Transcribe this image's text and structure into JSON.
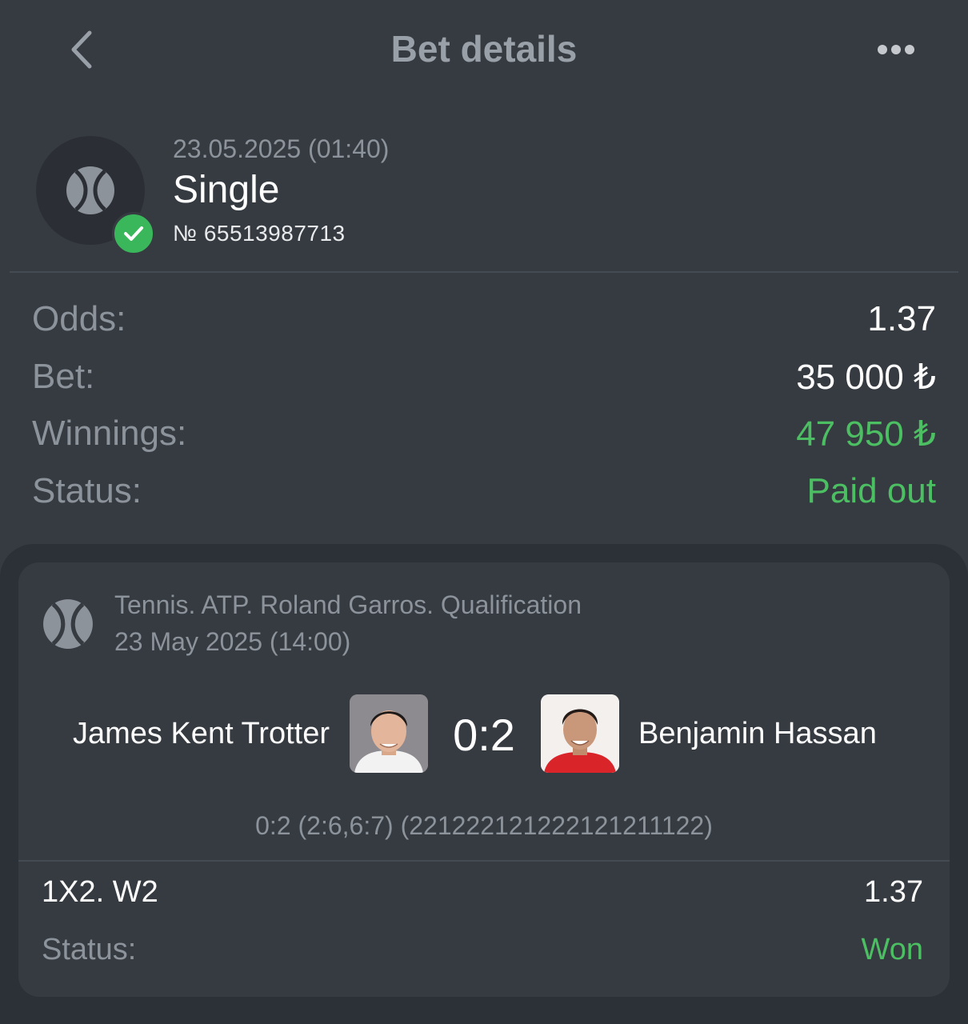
{
  "header": {
    "title": "Bet details",
    "back_icon": "chevron-left-icon",
    "more_icon": "more-horizontal-icon"
  },
  "summary": {
    "date": "23.05.2025 (01:40)",
    "type": "Single",
    "number": "№ 65513987713",
    "sport_icon": "tennis-ball-icon",
    "badge_icon": "check-icon"
  },
  "details": [
    {
      "label": "Odds:",
      "value": "1.37",
      "highlight": false
    },
    {
      "label": "Bet:",
      "value": "35 000 ₺",
      "highlight": false
    },
    {
      "label": "Winnings:",
      "value": "47 950 ₺",
      "highlight": true
    },
    {
      "label": "Status:",
      "value": "Paid out",
      "highlight": true
    }
  ],
  "event": {
    "tournament": "Tennis. ATP. Roland Garros. Qualification",
    "date": "23 May 2025 (14:00)",
    "team1": "James Kent Trotter",
    "team2": "Benjamin Hassan",
    "score": "0:2",
    "score_detail": "0:2 (2:6,6:7) (221222121222121211122)"
  },
  "pick": {
    "market": "1X2. W2",
    "odds": "1.37",
    "status_label": "Status:",
    "status_value": "Won"
  },
  "colors": {
    "background": "#363b42",
    "card": "#2c3037",
    "muted_text": "#8d939b",
    "success": "#4dbf63",
    "badge": "#3ab75a"
  }
}
